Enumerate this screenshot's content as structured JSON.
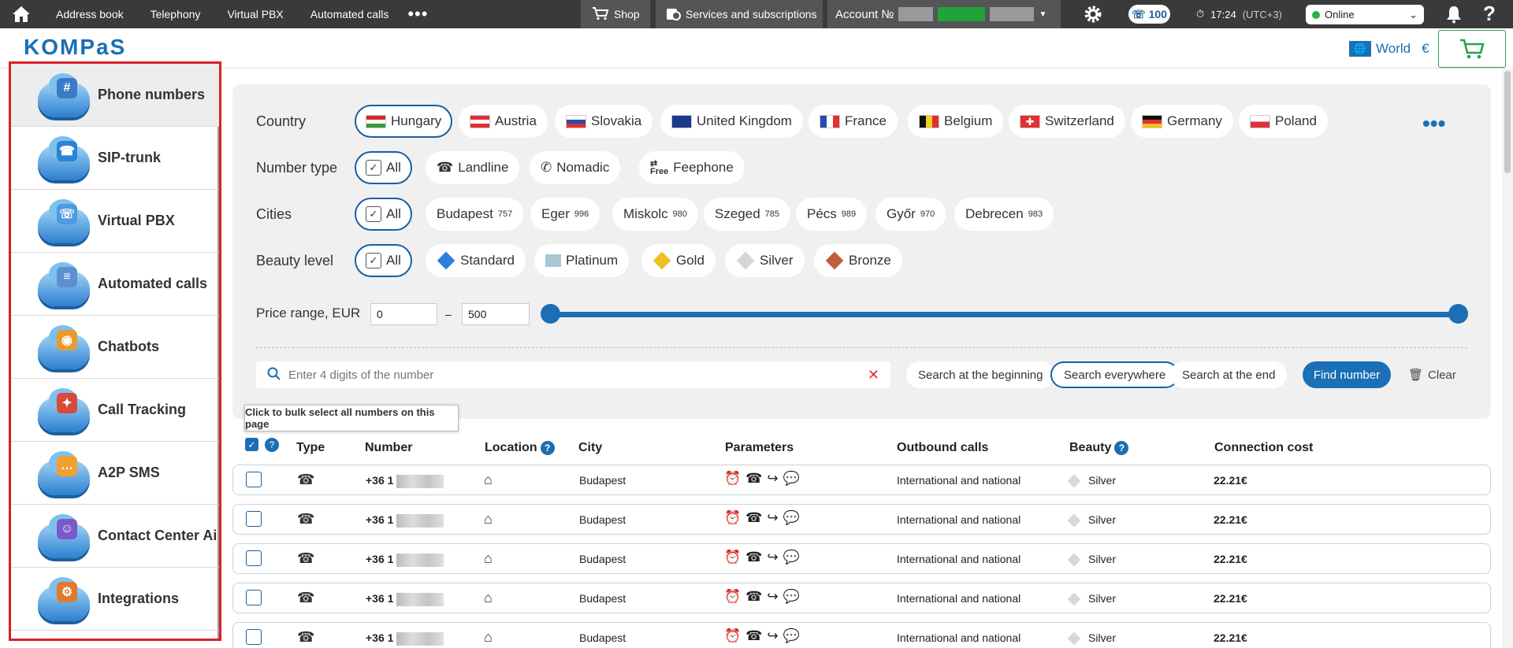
{
  "topbar": {
    "links": [
      "Address book",
      "Telephony",
      "Virtual PBX",
      "Automated calls"
    ],
    "shop": "Shop",
    "services": "Services and subscriptions",
    "account_label": "Account №",
    "badge_count": "100",
    "time": "17:24",
    "timezone": "(UTC+3)",
    "status": "Online"
  },
  "header": {
    "logo": "KOMPaS",
    "region": "World",
    "currency": "€"
  },
  "sidebar": {
    "items": [
      {
        "label": "Phone numbers",
        "icon": "phone-numbers-icon"
      },
      {
        "label": "SIP-trunk",
        "icon": "sip-trunk-icon"
      },
      {
        "label": "Virtual PBX",
        "icon": "virtual-pbx-icon"
      },
      {
        "label": "Automated calls",
        "icon": "automated-calls-icon"
      },
      {
        "label": "Chatbots",
        "icon": "chatbots-icon"
      },
      {
        "label": "Call Tracking",
        "icon": "call-tracking-icon"
      },
      {
        "label": "A2P SMS",
        "icon": "a2p-sms-icon"
      },
      {
        "label": "Contact Center Ai",
        "icon": "contact-center-icon"
      },
      {
        "label": "Integrations",
        "icon": "integrations-icon"
      }
    ]
  },
  "filters": {
    "country_label": "Country",
    "countries": [
      "Hungary",
      "Austria",
      "Slovakia",
      "United Kingdom",
      "France",
      "Belgium",
      "Switzerland",
      "Germany",
      "Poland"
    ],
    "number_type_label": "Number type",
    "number_types": [
      "All",
      "Landline",
      "Nomadic",
      "Feephone"
    ],
    "free_text": "Free",
    "cities_label": "Cities",
    "cities": [
      {
        "name": "All",
        "count": ""
      },
      {
        "name": "Budapest",
        "count": "757"
      },
      {
        "name": "Eger",
        "count": "996"
      },
      {
        "name": "Miskolc",
        "count": "980"
      },
      {
        "name": "Szeged",
        "count": "785"
      },
      {
        "name": "Pécs",
        "count": "989"
      },
      {
        "name": "Győr",
        "count": "970"
      },
      {
        "name": "Debrecen",
        "count": "983"
      }
    ],
    "beauty_label": "Beauty level",
    "beauty_levels": [
      "All",
      "Standard",
      "Platinum",
      "Gold",
      "Silver",
      "Bronze"
    ],
    "beauty_colors": {
      "Standard": "#2f7de1",
      "Platinum": "#a9c6d4",
      "Gold": "#f0c020",
      "Silver": "#d5d5d5",
      "Bronze": "#c0603a"
    },
    "price_label": "Price range, EUR",
    "price_min": "0",
    "price_max": "500",
    "price_separator": "–"
  },
  "search": {
    "placeholder": "Enter 4 digits of the number",
    "modes": [
      "Search at the beginning",
      "Search everywhere",
      "Search at the end"
    ],
    "find_label": "Find number",
    "clear_label": "Clear"
  },
  "table": {
    "tooltip": "Click to bulk select all numbers on this page",
    "columns": [
      "Type",
      "Number",
      "Location",
      "City",
      "Parameters",
      "Outbound calls",
      "Beauty",
      "Connection cost"
    ],
    "rows": [
      {
        "number": "+36 1",
        "city": "Budapest",
        "outbound": "International and national",
        "beauty": "Silver",
        "cost": "22.21€"
      },
      {
        "number": "+36 1",
        "city": "Budapest",
        "outbound": "International and national",
        "beauty": "Silver",
        "cost": "22.21€"
      },
      {
        "number": "+36 1",
        "city": "Budapest",
        "outbound": "International and national",
        "beauty": "Silver",
        "cost": "22.21€"
      },
      {
        "number": "+36 1",
        "city": "Budapest",
        "outbound": "International and national",
        "beauty": "Silver",
        "cost": "22.21€"
      },
      {
        "number": "+36 1",
        "city": "Budapest",
        "outbound": "International and national",
        "beauty": "Silver",
        "cost": "22.21€"
      }
    ]
  },
  "colors": {
    "accent": "#1a6fb5",
    "highlight_border": "#d8202a",
    "topbar": "#3a3a3a"
  }
}
